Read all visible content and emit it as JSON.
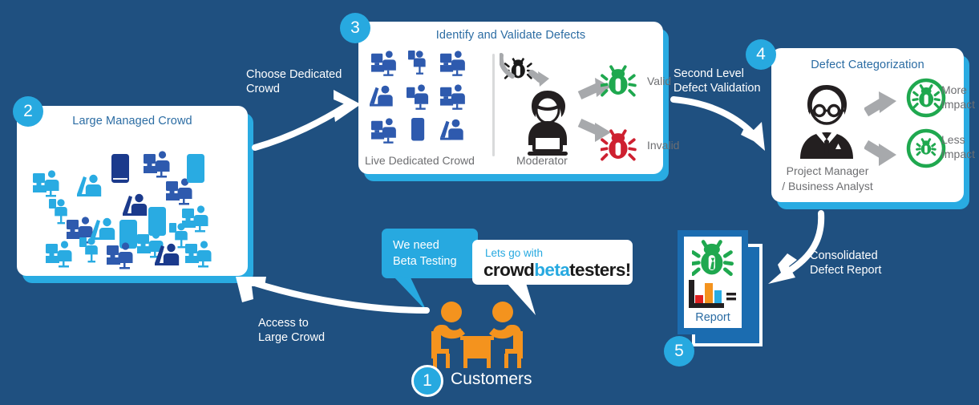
{
  "theme": {
    "background": "#1f5080",
    "accent_cyan": "#27A9E0",
    "panel_white": "#ffffff",
    "title_blue": "#2b6ca3",
    "caption_gray": "#6d6e71",
    "valid_green": "#1FA84F",
    "invalid_red": "#CE2030",
    "customer_orange": "#F4931E",
    "arrow_gray": "#A7A9AC",
    "report_blue": "#1B6CB0"
  },
  "steps": {
    "one": "1",
    "two": "2",
    "three": "3",
    "four": "4",
    "five": "5"
  },
  "panel_crowd": {
    "title": "Large Managed Crowd"
  },
  "panel_defects": {
    "title": "Identify and Validate Defects",
    "crowd_caption": "Live Dedicated Crowd",
    "moderator_caption": "Moderator",
    "valid_label": "Valid",
    "invalid_label": "Invalid"
  },
  "panel_categorization": {
    "title": "Defect Categorization",
    "role_line1": "Project Manager",
    "role_line2": "/ Business Analyst",
    "more_impact_line1": "More",
    "more_impact_line2": "Impact",
    "less_impact_line1": "Less",
    "less_impact_line2": "Impact"
  },
  "report": {
    "label": "Report"
  },
  "flow_labels": {
    "choose_crowd_line1": "Choose Dedicated",
    "choose_crowd_line2": "Crowd",
    "second_level_line1": "Second Level",
    "second_level_line2": "Defect Validation",
    "consolidated_line1": "Consolidated",
    "consolidated_line2": "Defect Report",
    "access_line1": "Access to",
    "access_line2": "Large Crowd"
  },
  "customers": {
    "label": "Customers"
  },
  "bubbles": {
    "need_line1": "We need",
    "need_line2": "Beta Testing",
    "lets_go": "Lets go with",
    "logo_part1": "crowd",
    "logo_part2": "beta",
    "logo_part3": "testers",
    "logo_bang": "!"
  }
}
